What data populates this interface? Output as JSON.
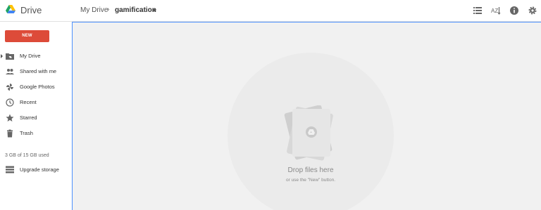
{
  "header": {
    "app_name": "Drive",
    "breadcrumb_root": "My Drive",
    "breadcrumb_separator": "›",
    "breadcrumb_current": "gamification",
    "sort_label": "AZ",
    "icons": [
      "drive-logo-icon",
      "list-view-icon",
      "sort-az-icon",
      "info-icon",
      "settings-gear-icon"
    ]
  },
  "sidebar": {
    "new_button_label": "NEW",
    "items": [
      {
        "label": "My Drive",
        "icon": "folder-icon"
      },
      {
        "label": "Shared with me",
        "icon": "people-icon"
      },
      {
        "label": "Google Photos",
        "icon": "photos-pinwheel-icon"
      },
      {
        "label": "Recent",
        "icon": "clock-icon"
      },
      {
        "label": "Starred",
        "icon": "star-icon"
      },
      {
        "label": "Trash",
        "icon": "trash-icon"
      }
    ],
    "storage_text": "3 GB of 15 GB used",
    "upgrade_label": "Upgrade storage"
  },
  "main": {
    "drop_title": "Drop files here",
    "drop_subtitle": "or use the \"New\" button."
  },
  "colors": {
    "new_button": "#dd4b39",
    "focus_border": "#4d90fe",
    "main_background": "#f1f1f1"
  }
}
